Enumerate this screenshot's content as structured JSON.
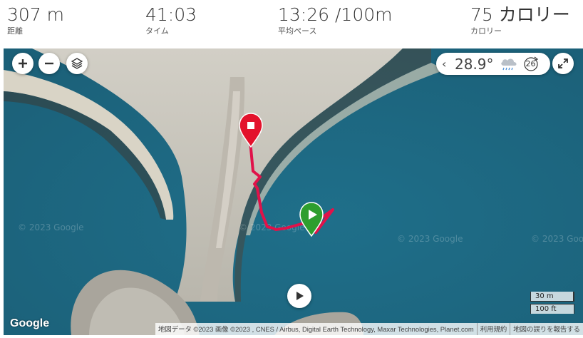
{
  "stats": {
    "distance": {
      "value": "307 m",
      "label": "距離"
    },
    "time": {
      "value": "41:03",
      "label": "タイム"
    },
    "pace": {
      "value": "13:26 /100m",
      "label": "平均ペース"
    },
    "calories": {
      "value": "75 カロリー",
      "label": "カロリー"
    }
  },
  "map": {
    "weather": {
      "temperature": "28.9°",
      "wind_speed": "26",
      "condition_icon": "rain-cloud-icon"
    },
    "scale": {
      "metric": "30 m",
      "imperial": "100 ft"
    },
    "logo": "Google",
    "watermark": "© 2023 Google",
    "attribution": {
      "data": "地図データ ©2023 画像 ©2023 , CNES / Airbus, Digital Earth Technology, Maxar Technologies, Planet.com",
      "terms": "利用規約",
      "report": "地図の誤りを報告する"
    },
    "colors": {
      "route": "#e0124a",
      "start_marker": "#2e9e2e",
      "end_marker": "#e3122c",
      "water": "#1e6f86",
      "sand": "#c9c6bd"
    }
  }
}
